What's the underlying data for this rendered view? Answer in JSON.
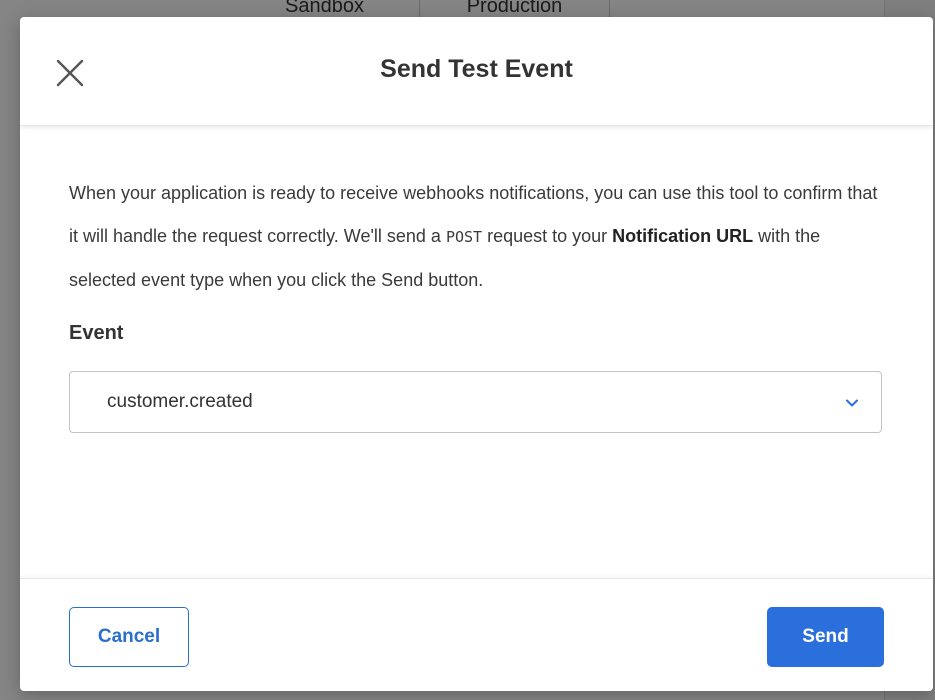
{
  "background": {
    "tabs": [
      "Sandbox",
      "Production"
    ]
  },
  "modal": {
    "title": "Send Test Event",
    "description": {
      "part1": "When your application is ready to receive webhooks notifications, you can use this tool to confirm that it will handle the request correctly. We'll send a ",
      "method": "POST",
      "part2": " request to your ",
      "url_label": "Notification URL",
      "part3": " with the selected event type when you click the Send button."
    },
    "event_label": "Event",
    "event_select": {
      "selected": "customer.created"
    },
    "footer": {
      "cancel_label": "Cancel",
      "send_label": "Send"
    }
  },
  "colors": {
    "primary": "#2a6fdb",
    "overlay": "rgba(0,0,0,0.48)"
  },
  "icons": {
    "close": "close-icon",
    "dropdown": "chevron-down-icon"
  }
}
